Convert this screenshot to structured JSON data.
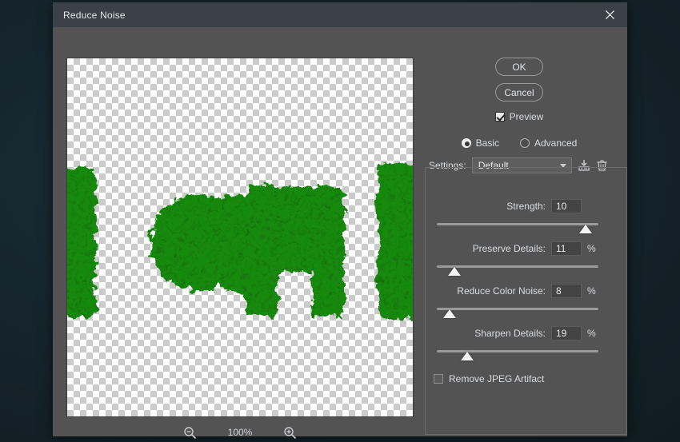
{
  "dialog": {
    "title": "Reduce Noise",
    "close_icon": "close-icon"
  },
  "preview": {
    "zoom_out_icon": "zoom-out-icon",
    "zoom_in_icon": "zoom-in-icon",
    "zoom_level": "100%",
    "content_description": "Leafy green 3D text on transparent checkerboard background"
  },
  "buttons": {
    "ok": "OK",
    "cancel": "Cancel"
  },
  "preview_toggle": {
    "label": "Preview",
    "checked": true
  },
  "mode": {
    "basic": "Basic",
    "advanced": "Advanced",
    "selected": "Basic"
  },
  "settings": {
    "label": "Settings:",
    "value": "Default",
    "save_icon": "save-preset-icon",
    "delete_icon": "trash-icon"
  },
  "sliders": [
    {
      "label": "Strength:",
      "value": "10",
      "unit": "",
      "percent": 92
    },
    {
      "label": "Preserve Details:",
      "value": "11",
      "unit": "%",
      "percent": 11
    },
    {
      "label": "Reduce Color Noise:",
      "value": "8",
      "unit": "%",
      "percent": 8
    },
    {
      "label": "Sharpen Details:",
      "value": "19",
      "unit": "%",
      "percent": 19
    }
  ],
  "jpeg": {
    "label": "Remove JPEG Artifact",
    "checked": false
  },
  "colors": {
    "dialog_bg": "#535353",
    "titlebar_bg": "#3b4049",
    "desktop_bg": "#16242b",
    "text": "#d9dce0",
    "leaf_green": "#3f8a2e"
  }
}
